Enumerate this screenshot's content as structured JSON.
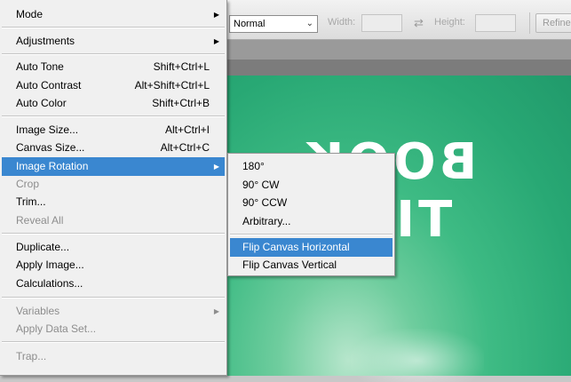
{
  "toolbar": {
    "style_value": "Normal",
    "width_label": "Width:",
    "height_label": "Height:",
    "refine_label": "Refine"
  },
  "canvas": {
    "line1": "BOOK",
    "line2": "TIT"
  },
  "menu": {
    "mode": "Mode",
    "adjustments": "Adjustments",
    "auto_tone": "Auto Tone",
    "auto_tone_sc": "Shift+Ctrl+L",
    "auto_contrast": "Auto Contrast",
    "auto_contrast_sc": "Alt+Shift+Ctrl+L",
    "auto_color": "Auto Color",
    "auto_color_sc": "Shift+Ctrl+B",
    "image_size": "Image Size...",
    "image_size_sc": "Alt+Ctrl+I",
    "canvas_size": "Canvas Size...",
    "canvas_size_sc": "Alt+Ctrl+C",
    "image_rotation": "Image Rotation",
    "crop": "Crop",
    "trim": "Trim...",
    "reveal_all": "Reveal All",
    "duplicate": "Duplicate...",
    "apply_image": "Apply Image...",
    "calculations": "Calculations...",
    "variables": "Variables",
    "apply_data_set": "Apply Data Set...",
    "trap": "Trap..."
  },
  "submenu": {
    "r180": "180°",
    "r90cw": "90° CW",
    "r90ccw": "90° CCW",
    "arbitrary": "Arbitrary...",
    "flip_h": "Flip Canvas Horizontal",
    "flip_v": "Flip Canvas Vertical"
  },
  "colors": {
    "menu_highlight": "#3a87d0",
    "canvas_green": "#28a874"
  }
}
